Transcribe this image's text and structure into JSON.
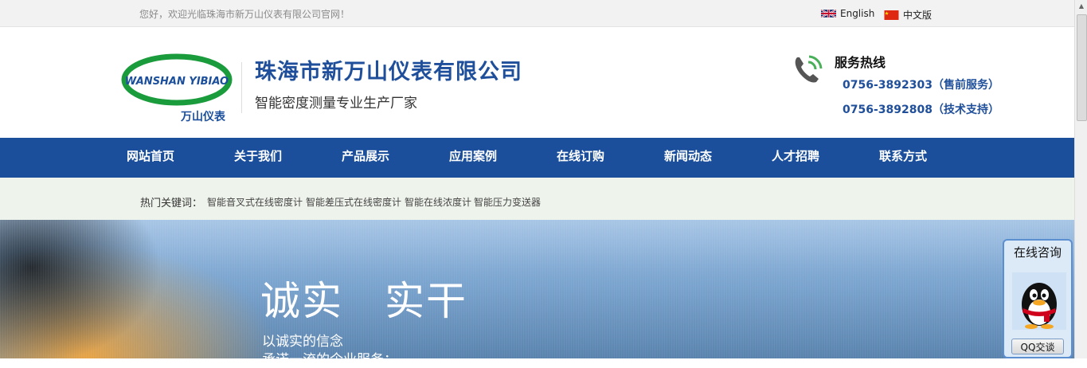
{
  "topbar": {
    "welcome": "您好，欢迎光临珠海市新万山仪表有限公司官网！",
    "lang_en": "English",
    "lang_cn": "中文版"
  },
  "header": {
    "logo_text": "WANSHAN YIBIAO",
    "logo_cn": "万山仪表",
    "company": "珠海市新万山仪表有限公司",
    "slogan": "智能密度测量专业生产厂家",
    "hotline_title": "服务热线",
    "hotline_1": "0756-3892303（售前服务）",
    "hotline_2": "0756-3892808（技术支持）"
  },
  "nav": [
    "网站首页",
    "关于我们",
    "产品展示",
    "应用案例",
    "在线订购",
    "新闻动态",
    "人才招聘",
    "联系方式"
  ],
  "keywords": {
    "label": "热门关键词：",
    "items": [
      "智能音叉式在线密度计",
      "智能差压式在线密度计",
      "智能在线浓度计",
      "智能压力变送器"
    ]
  },
  "banner": {
    "title": "诚实　实干",
    "line_1": "以诚实的信念",
    "line_2": "承诺一流的企业服务；"
  },
  "qq": {
    "title": "在线咨询",
    "button": "QQ交谈"
  },
  "colors": {
    "brand_blue": "#1b4f9c",
    "logo_green": "#1a9b3c"
  }
}
